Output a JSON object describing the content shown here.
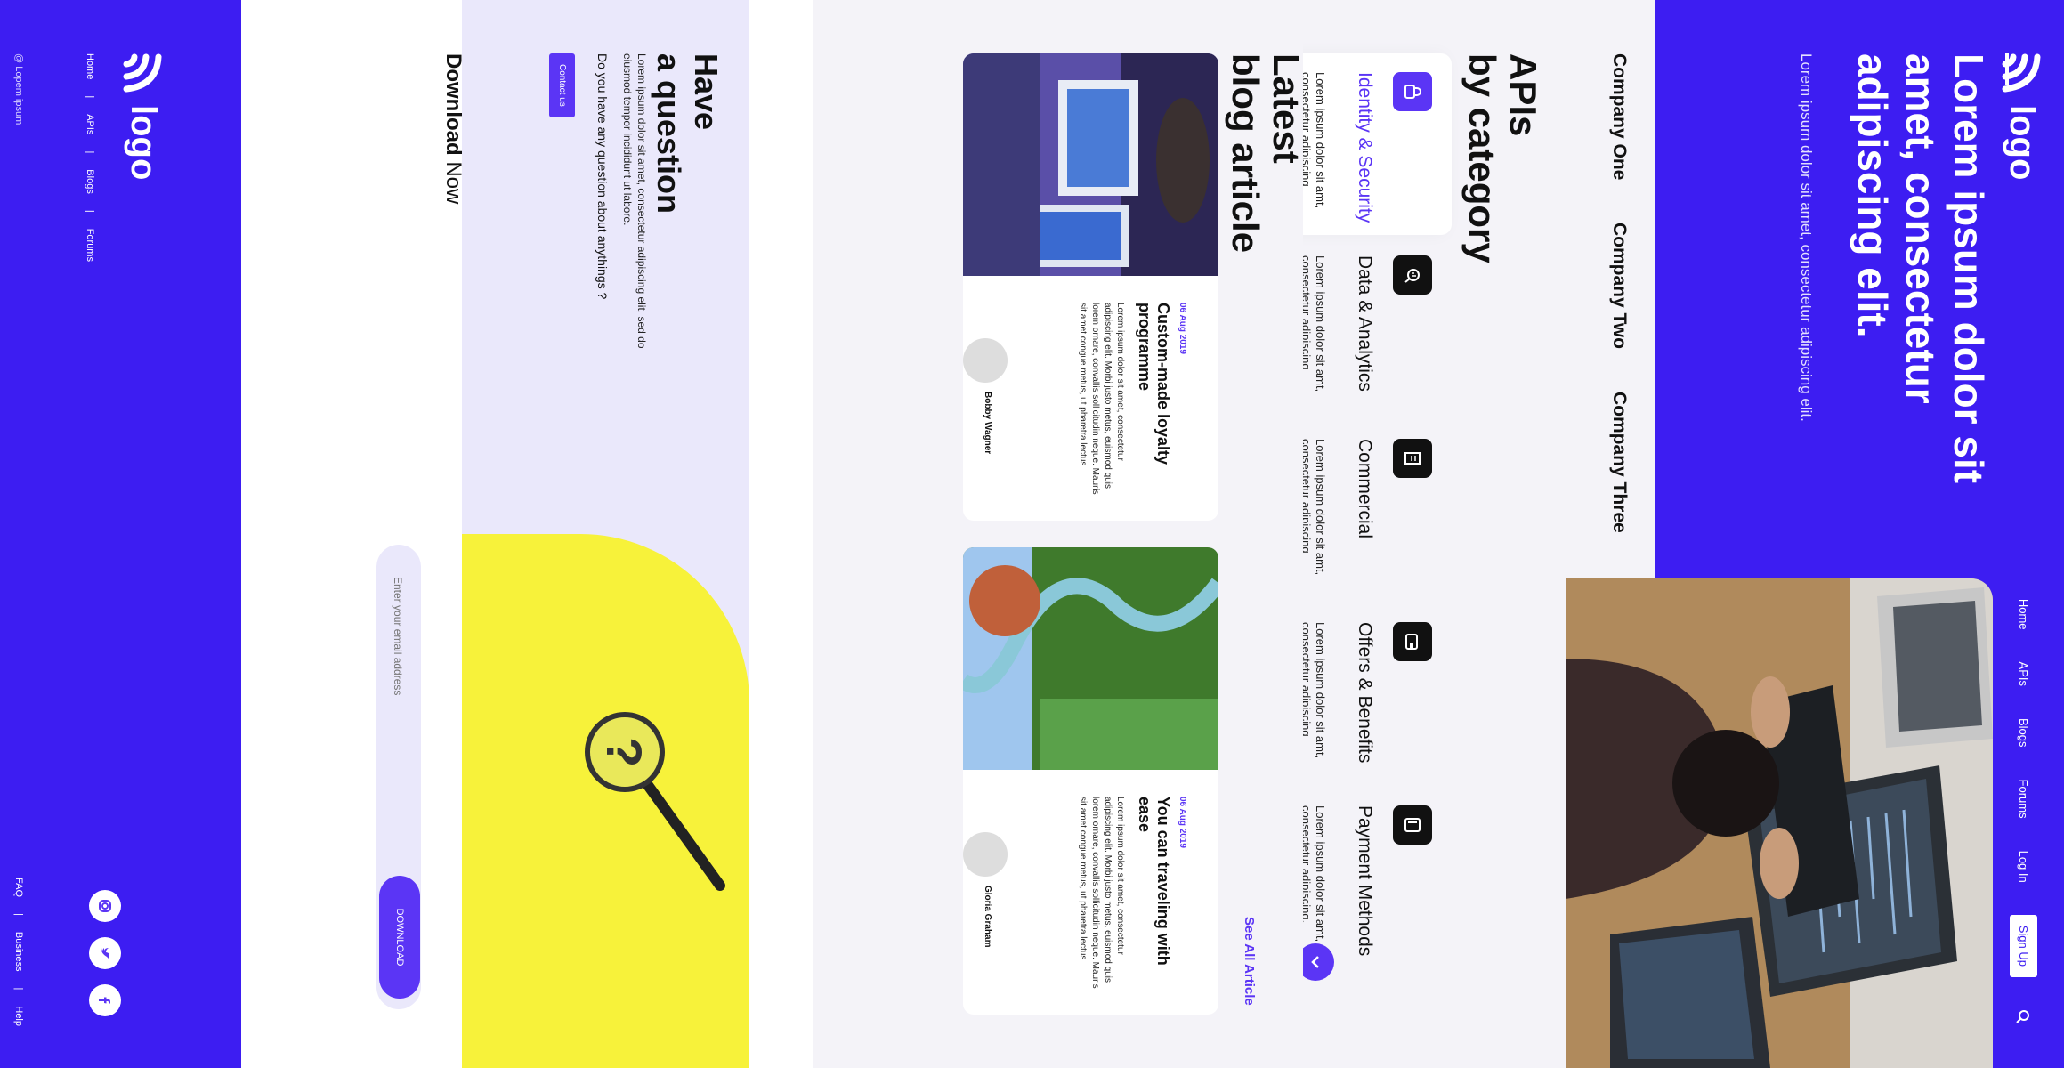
{
  "nav": {
    "logo": "logo",
    "items": [
      "Home",
      "APIs",
      "Blogs",
      "Forums",
      "Log In"
    ],
    "signup": "Sign Up",
    "search_icon": "search-icon"
  },
  "hero": {
    "title": "Lorem ipsum dolor sit amet, consectetur adipiscing elit.",
    "subtitle": "Lorem ipsum dolor sit amet, consectetur adipiscing elit."
  },
  "companies": [
    "Company One",
    "Company Two",
    "Company Three"
  ],
  "apis": {
    "heading_line1": "APIs",
    "heading_line2": "by category",
    "items": [
      {
        "title": "Identity & Security",
        "desc": "Lorem ipsum dolor sit amt, consectetur adipiscing",
        "icon": "lock-icon"
      },
      {
        "title": "Data & Analytics",
        "desc": "Lorem ipsum dolor sit amt, consectetur adipiscing",
        "icon": "analytics-icon"
      },
      {
        "title": "Commercial",
        "desc": "Lorem ipsum dolor sit amt, consectetur adipiscing",
        "icon": "receipt-icon"
      },
      {
        "title": "Offers & Benefits",
        "desc": "Lorem ipsum dolor sit amt, consectetur adipiscing",
        "icon": "wallet-icon"
      },
      {
        "title": "Payment Methods",
        "desc": "Lorem ipsum dolor sit amt, consectetur adipiscing.",
        "icon": "card-icon"
      }
    ]
  },
  "blog": {
    "heading_line1": "Latest",
    "heading_line2": "blog article",
    "see_all": "See All Article",
    "posts": [
      {
        "date": "06 Aug 2019",
        "title": "Custom-made loyalty programme",
        "text": "Lorem ipsum dolor sit amet, consectetur adipiscing elit. Morbi justo metus, euismod quis lorem ornare, convallis sollicitudin neque. Mauris sit amet congue metus, ut pharetra lectus",
        "author": "Bobby Wagner"
      },
      {
        "date": "06 Aug 2019",
        "title": "You can traveling with ease",
        "text": "Lorem ipsum dolor sit amet, consectetur adipiscing elit. Morbi justo metus, euismod quis lorem ornare, convallis sollicitudin neque. Mauris sit amet congue metus, ut pharetra lectus",
        "author": "Gloria Graham"
      }
    ]
  },
  "question": {
    "heading_line1": "Have",
    "heading_line2": "a question",
    "desc": "Lorem ipsum dolor sit amet, consectetur adipiscing elit, sed do eiusmod tempor incididunt ut labore.",
    "ask": "Do you have any question about anythings ?",
    "contact": "Contact us"
  },
  "download": {
    "title_bold": "Download",
    "title_light": "Now",
    "placeholder": "Enter your email address",
    "button": "DOWNLOAD"
  },
  "footer": {
    "logo": "logo",
    "links": [
      "Home",
      "APIs",
      "Blogs",
      "Forums"
    ],
    "copyright": "@ Lopem ipsum",
    "right_links": [
      "FAQ",
      "Business",
      "Help"
    ],
    "social_icons": [
      "instagram-icon",
      "twitter-icon",
      "facebook-icon"
    ]
  },
  "colors": {
    "brand": "#3d1df2",
    "accent": "#5b35f5",
    "soft": "#eae8fb",
    "highlight": "#f7f23a"
  }
}
